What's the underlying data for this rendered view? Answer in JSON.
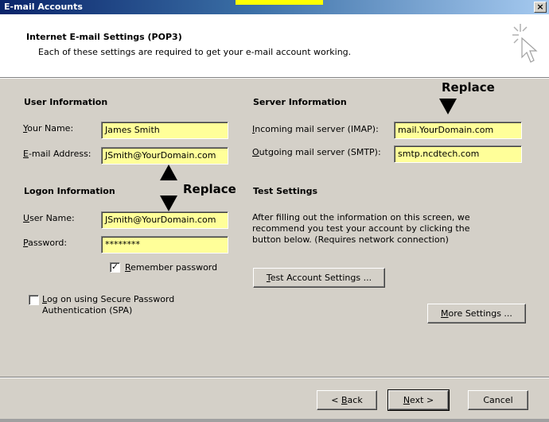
{
  "window": {
    "title": "E-mail Accounts",
    "close_glyph": "×"
  },
  "header": {
    "title": "Internet E-mail Settings (POP3)",
    "subtitle": "Each of these settings are required to get your e-mail account working.",
    "icon": "wizard-cursor-icon"
  },
  "user_info": {
    "title": "User Information",
    "your_name": {
      "key": "Y",
      "rest": "our Name:",
      "value": "James Smith"
    },
    "email": {
      "key": "E",
      "rest": "-mail Address:",
      "value": "JSmith@YourDomain.com"
    }
  },
  "server_info": {
    "title": "Server Information",
    "incoming": {
      "key": "I",
      "rest": "ncoming mail server (IMAP):",
      "value": "mail.YourDomain.com"
    },
    "outgoing": {
      "key": "O",
      "rest": "utgoing mail server (SMTP):",
      "value": "smtp.ncdtech.com"
    }
  },
  "logon_info": {
    "title": "Logon Information",
    "user_name": {
      "key": "U",
      "rest": "ser Name:",
      "value": "JSmith@YourDomain.com"
    },
    "password": {
      "key": "P",
      "rest": "assword:",
      "value": "********"
    },
    "remember": {
      "key": "R",
      "rest": "emember password",
      "checked": true
    },
    "spa": {
      "key": "L",
      "rest": "og on using Secure Password",
      "line2": "Authentication (SPA)",
      "checked": false
    }
  },
  "test_settings": {
    "title": "Test Settings",
    "description_lines": [
      "After filling out the information on this screen, we",
      "recommend you test your account by clicking the",
      "button below. (Requires network connection)"
    ],
    "test_button": {
      "key": "T",
      "rest": "est Account Settings ..."
    }
  },
  "more_settings": {
    "key": "M",
    "rest": "ore Settings ..."
  },
  "footer": {
    "back": {
      "pre": "< ",
      "key": "B",
      "rest": "ack"
    },
    "next": {
      "pre": "",
      "key": "N",
      "rest": "ext >"
    },
    "cancel": "Cancel"
  },
  "annotations": {
    "replace_1": "Replace",
    "replace_2": "Replace"
  },
  "colors": {
    "field_highlight": "#ffff99",
    "titlebar": "#0a246a",
    "dialog_bg": "#d4d0c8"
  }
}
